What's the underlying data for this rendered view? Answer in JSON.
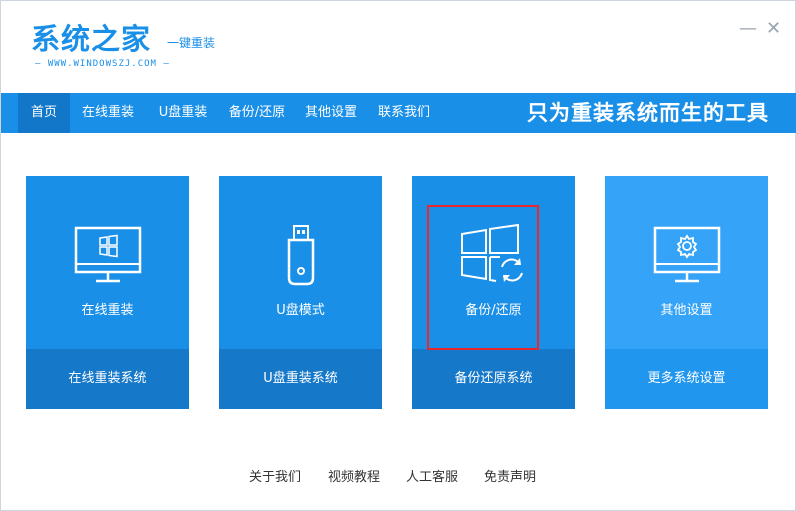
{
  "logo": {
    "main": "系统之家",
    "sub": "一键重装",
    "url": "— WWW.WINDOWSZJ.COM —"
  },
  "window_controls": {
    "minimize": "—",
    "close": "✕"
  },
  "nav": {
    "items": [
      {
        "label": "首页"
      },
      {
        "label": "在线重装"
      },
      {
        "label": "U盘重装"
      },
      {
        "label": "备份/还原"
      },
      {
        "label": "其他设置"
      },
      {
        "label": "联系我们"
      }
    ],
    "active_index": 0,
    "slogan": "只为重装系统而生的工具"
  },
  "cards": [
    {
      "title": "在线重装",
      "action": "在线重装系统",
      "icon": "monitor-windows-icon"
    },
    {
      "title": "U盘模式",
      "action": "U盘重装系统",
      "icon": "usb-drive-icon"
    },
    {
      "title": "备份/还原",
      "action": "备份还原系统",
      "icon": "windows-restore-icon"
    },
    {
      "title": "其他设置",
      "action": "更多系统设置",
      "icon": "monitor-gear-icon"
    }
  ],
  "footer": {
    "links": [
      "关于我们",
      "视频教程",
      "人工客服",
      "免责声明"
    ]
  },
  "colors": {
    "primary": "#1a8fe8",
    "primary_dark": "#1678c9",
    "highlight": "#e8282d"
  }
}
